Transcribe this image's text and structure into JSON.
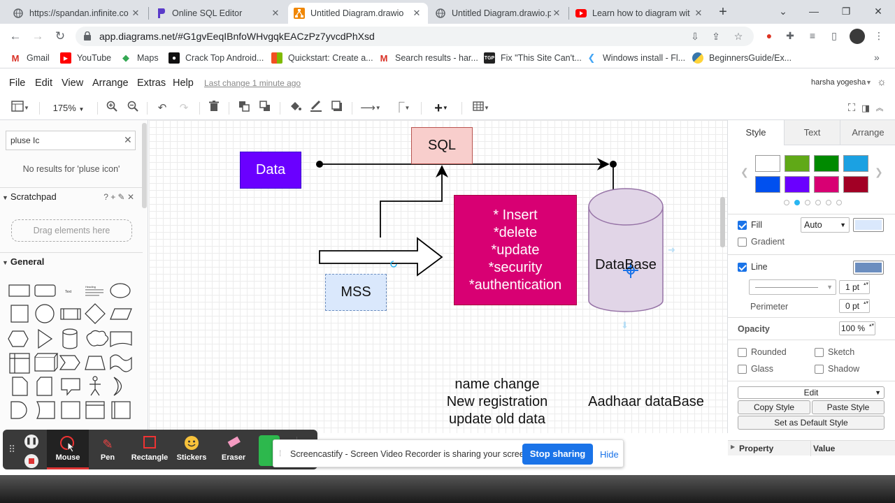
{
  "browser": {
    "tabs": [
      {
        "title": "https://spandan.infinite.co",
        "icon": "globe-icon",
        "active": false
      },
      {
        "title": "Online SQL Editor",
        "icon": "programiz-icon",
        "active": false
      },
      {
        "title": "Untitled Diagram.drawio",
        "icon": "drawio-icon",
        "active": true
      },
      {
        "title": "Untitled Diagram.drawio.p",
        "icon": "globe-icon",
        "active": false
      },
      {
        "title": "Learn how to diagram wit",
        "icon": "youtube-icon",
        "active": false
      }
    ],
    "url": "app.diagrams.net/#G1gvEeqIBnfoWHvgqkEACzPz7yvcdPhXsd",
    "bookmarks": [
      {
        "label": "Gmail",
        "icon": "gmail-icon",
        "color": "#d93025",
        "glyph": "M"
      },
      {
        "label": "YouTube",
        "icon": "youtube-icon",
        "color": "#ff0000",
        "glyph": "▶"
      },
      {
        "label": "Maps",
        "icon": "maps-icon",
        "color": "#34a853",
        "glyph": "◆"
      },
      {
        "label": "Crack Top Android...",
        "icon": "medium-icon",
        "color": "#111111",
        "glyph": "●"
      },
      {
        "label": "Quickstart: Create a...",
        "icon": "microsoft-icon",
        "color": "#f25022",
        "glyph": "■"
      },
      {
        "label": "Search results - har...",
        "icon": "gmail-icon",
        "color": "#d93025",
        "glyph": "M"
      },
      {
        "label": "Fix \"This Site Can't...",
        "icon": "tgp-icon",
        "color": "#222222",
        "glyph": "T"
      },
      {
        "label": "Windows install - Fl...",
        "icon": "flutter-icon",
        "color": "#42a5f5",
        "glyph": "◣"
      },
      {
        "label": "BeginnersGuide/Ex...",
        "icon": "python-icon",
        "color": "#3776ab",
        "glyph": "●"
      }
    ]
  },
  "app": {
    "menu": [
      "File",
      "Edit",
      "View",
      "Arrange",
      "Extras",
      "Help"
    ],
    "last_change": "Last change 1 minute ago",
    "user": "harsha yogesha",
    "zoom": "175%"
  },
  "sidebar": {
    "search_value": "pluse Ic",
    "no_results": "No results for 'pluse icon'",
    "scratchpad_title": "Scratchpad",
    "scratchpad_tools": "? + ✎ ✕",
    "drag_hint": "Drag elements here",
    "general_title": "General"
  },
  "diagram": {
    "data_label": "Data",
    "sql_label": "SQL",
    "mss_label": "MSS",
    "ops_lines": [
      "* Insert",
      "*delete",
      "*update",
      "*security",
      "*authentication"
    ],
    "database_label": "DataBase",
    "notes_lines": [
      "name change",
      "New registration",
      "update old data"
    ],
    "aadhaar_label": "Aadhaar dataBase",
    "colors": {
      "data": "#6a00ff",
      "sql": "#f8cecc",
      "mss": "#dae8fc",
      "ops": "#d80073",
      "db": "#e1d5e7"
    }
  },
  "format": {
    "tabs": [
      "Style",
      "Text",
      "Arrange"
    ],
    "swatches": [
      "#ffffff",
      "#60a917",
      "#008a00",
      "#1ba1e2",
      "#0050ef",
      "#6a00ff",
      "#d80073",
      "#a20025"
    ],
    "fill_label": "Fill",
    "fill_mode": "Auto",
    "fill_color": "#dae8fc",
    "gradient_label": "Gradient",
    "line_label": "Line",
    "line_color": "#6c8ebf",
    "line_width": "1 pt",
    "perimeter_label": "Perimeter",
    "perimeter_value": "0 pt",
    "opacity_label": "Opacity",
    "opacity_value": "100 %",
    "rounded_label": "Rounded",
    "sketch_label": "Sketch",
    "glass_label": "Glass",
    "shadow_label": "Shadow",
    "edit_label": "Edit",
    "copy_style": "Copy Style",
    "paste_style": "Paste Style",
    "default_style": "Set as Default Style",
    "property_col": "Property",
    "value_col": "Value"
  },
  "screencast": {
    "tools": [
      "Mouse",
      "Pen",
      "Rectangle",
      "Stickers",
      "Eraser"
    ],
    "share_message": "Screencastify - Screen Video Recorder is sharing your screen.",
    "stop_label": "Stop sharing",
    "hide_label": "Hide"
  }
}
